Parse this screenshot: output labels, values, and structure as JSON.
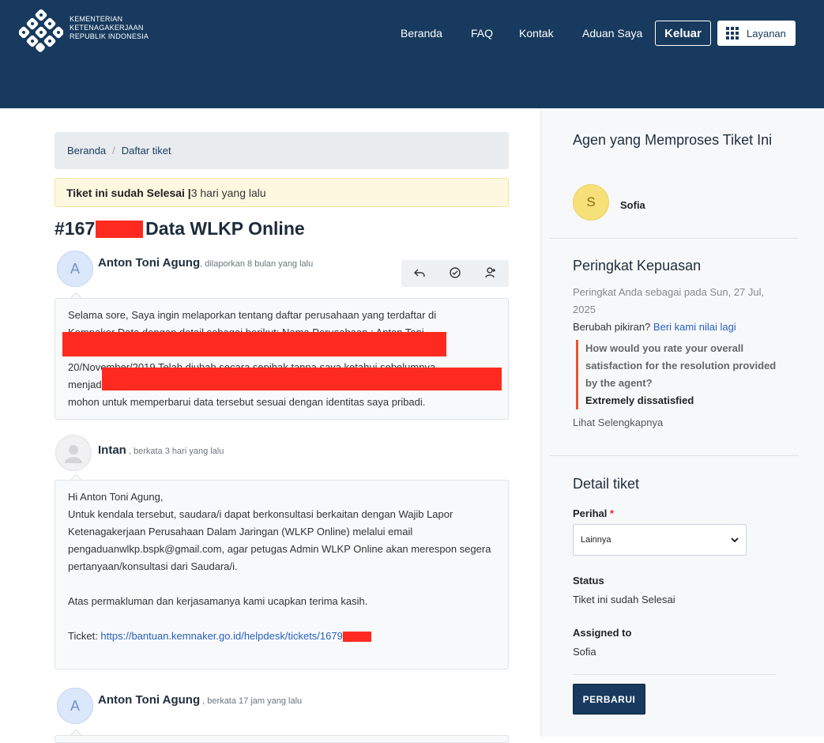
{
  "header": {
    "org_line1": "KEMENTERIAN",
    "org_line2": "KETENAGAKERJAAN",
    "org_line3": "REPUBLIK INDONESIA",
    "nav": [
      "Beranda",
      "FAQ",
      "Kontak",
      "Aduan Saya"
    ],
    "logout_label": "Keluar",
    "services_label": "Layanan"
  },
  "breadcrumb": [
    "Beranda",
    "Daftar tiket"
  ],
  "status_banner": {
    "bold": "Tiket ini sudah Selesai |",
    "time": " 3 hari yang lalu"
  },
  "ticket": {
    "id_prefix": "#167",
    "title": "Data WLKP Online"
  },
  "messages": [
    {
      "author": "Anton Toni Agung",
      "meta": ", dilaporkan 8 bulan yang lalu",
      "avatar_letter": "A",
      "lines": [
        "Selama sore, Saya ingin melaporkan tentang daftar perusahaan yang terdaftar di",
        "Kemnaker Data dengan detail sebagai berikut: Nama Perusahaan : Anton Toni",
        "",
        "20/November/2019 Telah diubah secara sepihak tanpa saya ketahui sebelumnya",
        "menjadi",
        "mohon untuk memperbarui data tersebut sesuai dengan identitas saya pribadi."
      ]
    },
    {
      "author": "Intan",
      "meta": " , berkata 3 hari yang lalu",
      "lines": [
        "Hi Anton Toni Agung,",
        "Untuk kendala tersebut, saudara/i dapat berkonsultasi berkaitan dengan Wajib Lapor",
        "Ketenagakerjaan Perusahaan Dalam Jaringan (WLKP Online) melalui email",
        "pengaduanwlkp.bspk@gmail.com, agar petugas Admin WLKP Online akan merespon segera",
        "pertanyaan/konsultasi dari Saudara/i.",
        "",
        " Atas permakluman dan kerjasamanya kami ucapkan terima kasih.",
        ""
      ],
      "ticket_label": "Ticket: ",
      "ticket_link": "https://bantuan.kemnaker.go.id/helpdesk/tickets/1679"
    },
    {
      "author": "Anton Toni Agung",
      "meta": " , berkata 17 jam yang lalu",
      "avatar_letter": "A"
    }
  ],
  "sidebar": {
    "agent_heading": "Agen yang Memproses Tiket Ini",
    "agent_initial": "S",
    "agent_name": "Sofia",
    "rating_heading": "Peringkat Kepuasan",
    "rating_text": "Peringkat Anda sebagai pada Sun, 27 Jul, 2025",
    "change_mind": "Berubah pikiran?",
    "rate_again": "Beri kami nilai lagi",
    "question": "How would you rate your overall satisfaction for the resolution provided by the agent?",
    "answer": "Extremely dissatisfied",
    "see_more": "Lihat Selengkapnya",
    "detail_heading": "Detail tiket",
    "perihal_label": "Perihal",
    "perihal_value": "Lainnya",
    "status_label": "Status",
    "status_value": "Tiket ini sudah Selesai",
    "assigned_label": "Assigned to",
    "assigned_value": "Sofia",
    "update_button": "PERBARUI"
  },
  "colors": {
    "header": "#173a5e",
    "redaction": "#ff2a1f",
    "accent": "#e8552b"
  }
}
